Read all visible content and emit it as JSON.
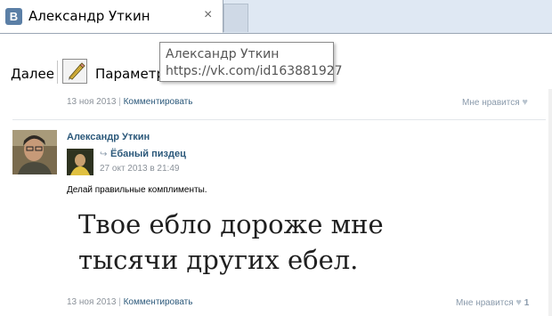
{
  "browser": {
    "tab": {
      "favicon_letter": "В",
      "title": "Александр Уткин",
      "close_glyph": "×"
    },
    "toolbar": {
      "next_label": "Далее",
      "params_label": "Параметры"
    },
    "tooltip": {
      "name": "Александр Уткин",
      "url": "https://vk.com/id163881927"
    }
  },
  "feed": {
    "prev_post": {
      "date": "13 ноя 2013",
      "separator": "|",
      "comment_label": "Комментировать",
      "like_label": "Мне нравится"
    },
    "post": {
      "author": "Александр Уткин",
      "repost": {
        "group_name": "Ёбаный пиздец",
        "date": "27 окт 2013 в 21:49"
      },
      "text": "Делай правильные комплименты.",
      "image_text": "Твое ебло дороже мне тысячи других ебел.",
      "date": "13 ноя 2013",
      "separator": "|",
      "comment_label": "Комментировать",
      "like_label": "Мне нравится",
      "like_count": "1"
    }
  },
  "colors": {
    "link": "#2b587a",
    "meta_gray": "#8a9199",
    "tab_strip": "#dfe8f3",
    "vk_blue": "#5b7fa6"
  },
  "icons": [
    "vk-favicon-icon",
    "close-icon",
    "pencil-icon",
    "heart-icon",
    "repost-arrow-icon"
  ]
}
